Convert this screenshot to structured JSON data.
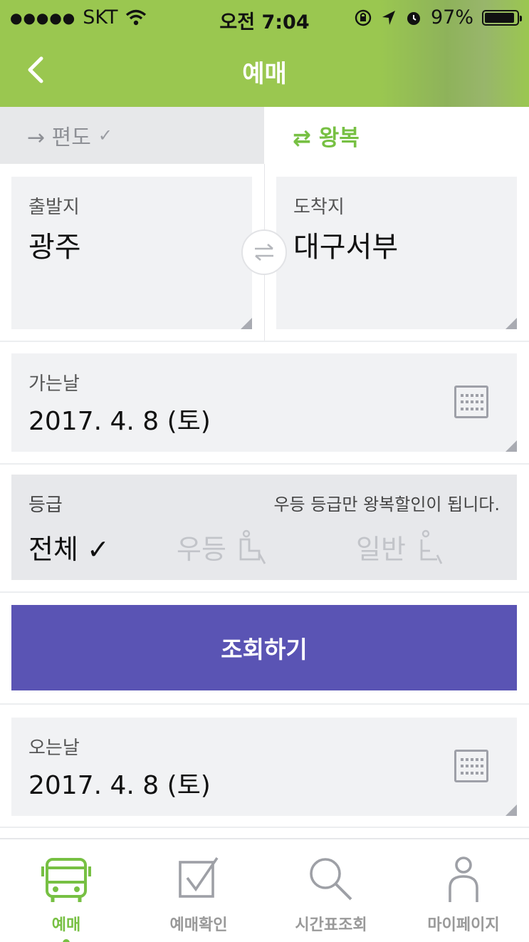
{
  "status_bar": {
    "signal_dots": "●●●●●",
    "carrier": "SKT",
    "time": "오전 7:04",
    "battery": "97%"
  },
  "header": {
    "title": "예매",
    "back_icon": "chevron-left-icon"
  },
  "trip_type": {
    "oneway_label": "→ 편도",
    "oneway_check": "✓",
    "roundtrip_label": "⇄ 왕복",
    "selected": "roundtrip"
  },
  "departure": {
    "label": "출발지",
    "value": "광주"
  },
  "arrival": {
    "label": "도착지",
    "value": "대구서부"
  },
  "swap_icon": "swap-arrows-icon",
  "departure_date": {
    "label": "가는날",
    "value": "2017. 4. 8 (토)"
  },
  "grade": {
    "label": "등급",
    "note": "우등 등급만 왕복할인이 됩니다.",
    "options": [
      {
        "label": "전체 ✓",
        "selected": true
      },
      {
        "label": "우등",
        "selected": false
      },
      {
        "label": "일반",
        "selected": false
      }
    ]
  },
  "search_button": "조회하기",
  "return_date": {
    "label": "오는날",
    "value": "2017. 4. 8 (토)"
  },
  "tabbar": {
    "items": [
      {
        "label": "예매",
        "icon": "bus-icon",
        "active": true
      },
      {
        "label": "예매확인",
        "icon": "checkbox-icon",
        "active": false
      },
      {
        "label": "시간표조회",
        "icon": "search-icon",
        "active": false
      },
      {
        "label": "마이페이지",
        "icon": "person-icon",
        "active": false
      }
    ]
  },
  "colors": {
    "header": "#9ac750",
    "accent_green": "#77c043",
    "search_button": "#5a54b4"
  }
}
